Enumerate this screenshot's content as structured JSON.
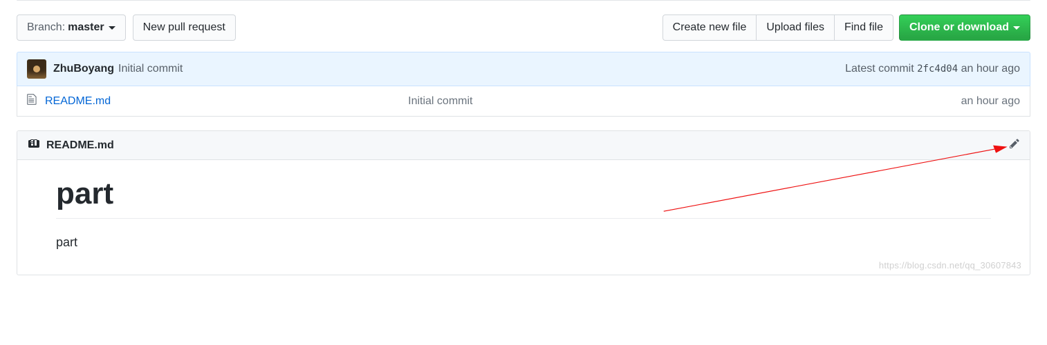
{
  "toolbar": {
    "branch_label": "Branch:",
    "branch_name": "master",
    "new_pr": "New pull request",
    "create_file": "Create new file",
    "upload_files": "Upload files",
    "find_file": "Find file",
    "clone": "Clone or download"
  },
  "commit": {
    "author": "ZhuBoyang",
    "message": "Initial commit",
    "latest_label": "Latest commit",
    "sha": "2fc4d04",
    "time": "an hour ago"
  },
  "files": [
    {
      "name": "README.md",
      "message": "Initial commit",
      "time": "an hour ago"
    }
  ],
  "readme": {
    "filename": "README.md",
    "title": "part",
    "body": "part"
  },
  "watermark": "https://blog.csdn.net/qq_30607843"
}
